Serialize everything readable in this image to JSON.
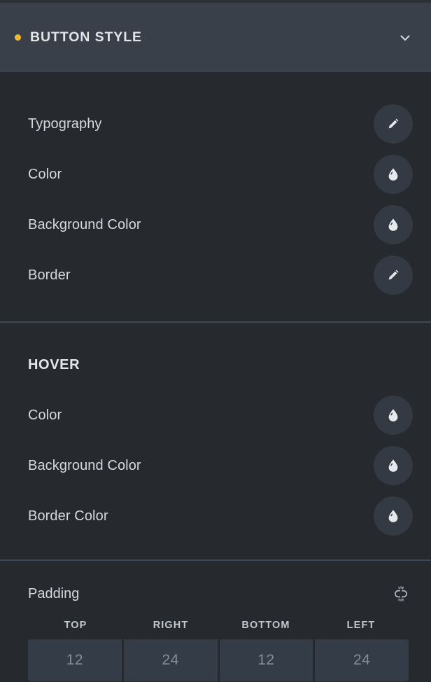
{
  "panel": {
    "header": {
      "title": "BUTTON STYLE",
      "indicator_icon": "dot-indicator-icon",
      "indicator_color": "#f2b92c",
      "collapse_icon": "chevron-down-icon"
    },
    "theme": {
      "header_bg": "#3a4049",
      "body_bg": "#26292e",
      "divider": "#3f4752",
      "label_text": "#d5d9dd",
      "action_bg": "#333a44",
      "input_bg": "#343c47",
      "input_text": "#868d96",
      "accent": "#f2b92c"
    },
    "main_group": {
      "controls": [
        {
          "label": "Typography",
          "icon": "pencil-icon",
          "control": "typography-editor"
        },
        {
          "label": "Color",
          "icon": "color-drop-icon",
          "control": "color-picker"
        },
        {
          "label": "Background Color",
          "icon": "color-drop-icon",
          "control": "color-picker"
        },
        {
          "label": "Border",
          "icon": "pencil-icon",
          "control": "border-editor"
        }
      ]
    },
    "hover_group": {
      "heading": "HOVER",
      "controls": [
        {
          "label": "Color",
          "icon": "color-drop-icon",
          "control": "color-picker"
        },
        {
          "label": "Background Color",
          "icon": "color-drop-icon",
          "control": "color-picker"
        },
        {
          "label": "Border Color",
          "icon": "color-drop-icon",
          "control": "color-picker"
        }
      ]
    },
    "padding_group": {
      "title": "Padding",
      "link_icon": "unlinked-chain-icon",
      "link_state": "unlinked",
      "fields": [
        {
          "label": "TOP",
          "value": "12"
        },
        {
          "label": "RIGHT",
          "value": "24"
        },
        {
          "label": "BOTTOM",
          "value": "12"
        },
        {
          "label": "LEFT",
          "value": "24"
        }
      ]
    }
  }
}
